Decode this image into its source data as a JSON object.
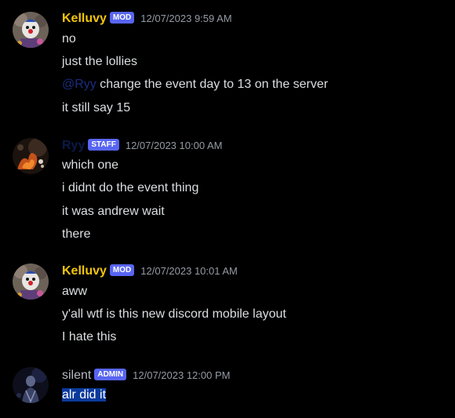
{
  "colors": {
    "background": "#000000",
    "text": "#dbdee1",
    "mod_name": "#f1c40f",
    "staff_name": "#0c1a4a",
    "admin_name": "#b5bac1",
    "badge_bg": "#5865f2",
    "timestamp": "#949ba4",
    "mention": "#1a2d80",
    "selection": "#0b3a9c"
  },
  "messages": [
    {
      "user": "Kelluvy",
      "badge": "MOD",
      "timestamp": "12/07/2023 9:59 AM",
      "avatar_icon": "clown-avatar",
      "lines": [
        {
          "text": "no"
        },
        {
          "text": "just the lollies"
        },
        {
          "mention": "@Ryy",
          "text": " change the event day to 13 on the server"
        },
        {
          "text": "it still say 15"
        }
      ]
    },
    {
      "user": "Ryy",
      "badge": "STAFF",
      "timestamp": "12/07/2023 10:00 AM",
      "avatar_icon": "fire-avatar",
      "lines": [
        {
          "text": "which one"
        },
        {
          "text": "i didnt do the event thing"
        },
        {
          "text": "it was andrew wait"
        },
        {
          "text": "there"
        }
      ]
    },
    {
      "user": "Kelluvy",
      "badge": "MOD",
      "timestamp": "12/07/2023 10:01 AM",
      "avatar_icon": "clown-avatar",
      "lines": [
        {
          "text": "aww"
        },
        {
          "text": "y'all wtf is this new discord mobile layout"
        },
        {
          "text": "I hate this"
        }
      ]
    },
    {
      "user": "silent",
      "badge": "ADMIN",
      "timestamp": "12/07/2023 12:00 PM",
      "avatar_icon": "dark-figure-avatar",
      "lines": [
        {
          "text": "alr did it",
          "selected": true
        }
      ]
    }
  ]
}
